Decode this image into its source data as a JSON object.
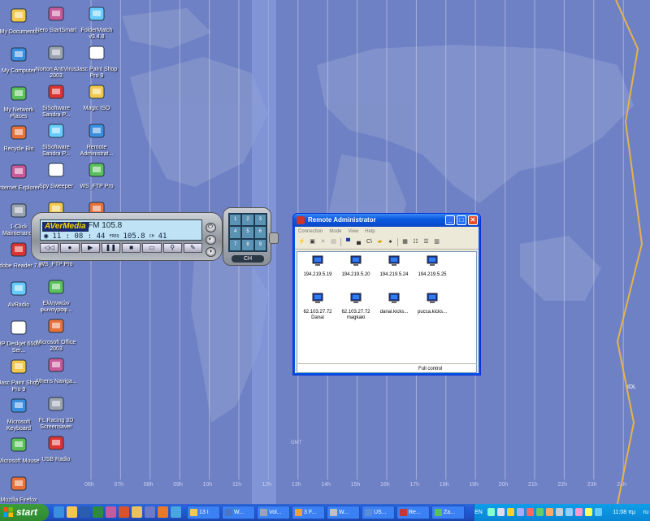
{
  "desktop": {
    "timezone_labels": [
      "06h",
      "07h",
      "08h",
      "09h",
      "10h",
      "11h",
      "12h",
      "13h",
      "14h",
      "15h",
      "16h",
      "17h",
      "18h",
      "19h",
      "20h",
      "21h",
      "22h",
      "23h",
      "24h"
    ],
    "map_labels": {
      "gmt": "GMT",
      "idl": "IDL"
    },
    "icons": [
      {
        "label": "My Documents",
        "icon": "folder-doc-icon"
      },
      {
        "label": "My Computer",
        "icon": "computer-icon"
      },
      {
        "label": "My Network Places",
        "icon": "network-icon"
      },
      {
        "label": "Recycle Bin",
        "icon": "recycle-bin-icon"
      },
      {
        "label": "Internet Explorer",
        "icon": "internet-explorer-icon"
      },
      {
        "label": "1-Click Maintenance",
        "icon": "maintenance-icon"
      },
      {
        "label": "Adobe Reader 7.0",
        "icon": "adobe-reader-icon"
      },
      {
        "label": "AvRadio",
        "icon": "avradio-icon"
      },
      {
        "label": "HP Deskjet 6500 Ser...",
        "icon": "printer-icon"
      },
      {
        "label": "Jasc Paint Shop Pro 9",
        "icon": "paint-shop-icon"
      },
      {
        "label": "Microsoft Keyboard",
        "icon": "keyboard-icon"
      },
      {
        "label": "Microsoft Mouse",
        "icon": "mouse-icon"
      },
      {
        "label": "Mozilla Firefox",
        "icon": "firefox-icon"
      },
      {
        "label": "Nero StartSmart",
        "icon": "nero-icon"
      },
      {
        "label": "Norton AntiVirus 2003",
        "icon": "norton-icon"
      },
      {
        "label": "SiSoftware Sandra P...",
        "icon": "sisoftware-icon"
      },
      {
        "label": "SiSoftware Sandra P...",
        "icon": "sisoftware-icon"
      },
      {
        "label": "Spy Sweeper",
        "icon": "spy-sweeper-icon"
      },
      {
        "label": "",
        "icon": "recycle-icon"
      },
      {
        "label": "WS_FTP Pro",
        "icon": "ftp-icon"
      },
      {
        "label": "Ελληνικών φωνογραφ...",
        "icon": "greek-program-icon"
      },
      {
        "label": "Microsoft Office 2003",
        "icon": "folder-icon"
      },
      {
        "label": "Athens Naviga...",
        "icon": "athens-nav-icon"
      },
      {
        "label": "FL Racing 3D Screensaver",
        "icon": "racing-icon"
      },
      {
        "label": "USB Radio",
        "icon": "usb-radio-icon"
      },
      {
        "label": "FolderMatch v3.4.8",
        "icon": "foldermatch-icon"
      },
      {
        "label": "Jasc Paint Shop Pro 9",
        "icon": "paint-shop-icon"
      },
      {
        "label": "Magic ISO",
        "icon": "magiciso-icon"
      },
      {
        "label": "Remote Administrat...",
        "icon": "remote-admin-icon"
      },
      {
        "label": "WS_FTP Pro",
        "icon": "ftp-icon"
      },
      {
        "label": "",
        "icon": "folder-icon"
      }
    ]
  },
  "radio": {
    "brand": "AVerMedia",
    "station": "FM 105.8",
    "time": "11 : 08 : 44",
    "freq_label": "FREQ",
    "freq": "105.8",
    "ch_label": "CH",
    "channel": "41",
    "keypad_label": "CH",
    "buttons": [
      "◁◁",
      "●",
      "▶",
      "❚❚",
      "■",
      "▭",
      "⚲",
      "✎"
    ]
  },
  "remote_admin": {
    "title": "Remote Administrator",
    "menu": [
      "Connection",
      "Mode",
      "View",
      "Help"
    ],
    "hosts": [
      {
        "label": "194.219.5.19"
      },
      {
        "label": "194.219.5.20"
      },
      {
        "label": "194.219.5.24"
      },
      {
        "label": "194.219.5.25"
      },
      {
        "label": "62.103.27.72 Danai"
      },
      {
        "label": "62.103.27.72 magkaki"
      },
      {
        "label": "danai.kicks..."
      },
      {
        "label": "pucca.kicks..."
      }
    ],
    "status": "Full control"
  },
  "taskbar": {
    "start": "start",
    "tasks": [
      {
        "label": "13 I",
        "color": "#f2c94c"
      },
      {
        "label": "W...",
        "color": "#4a76c4"
      },
      {
        "label": "Vol...",
        "color": "#9aa3b0"
      },
      {
        "label": "3 F...",
        "color": "#e8a33a"
      },
      {
        "label": "W...",
        "color": "#c0c0c0"
      },
      {
        "label": "US...",
        "color": "#5b8dd8"
      },
      {
        "label": "Re...",
        "color": "#c33"
      },
      {
        "label": "Za...",
        "color": "#5ac05a"
      }
    ],
    "lang": "EN",
    "clock": "11:08 πμ",
    "keyboard": "ru"
  }
}
